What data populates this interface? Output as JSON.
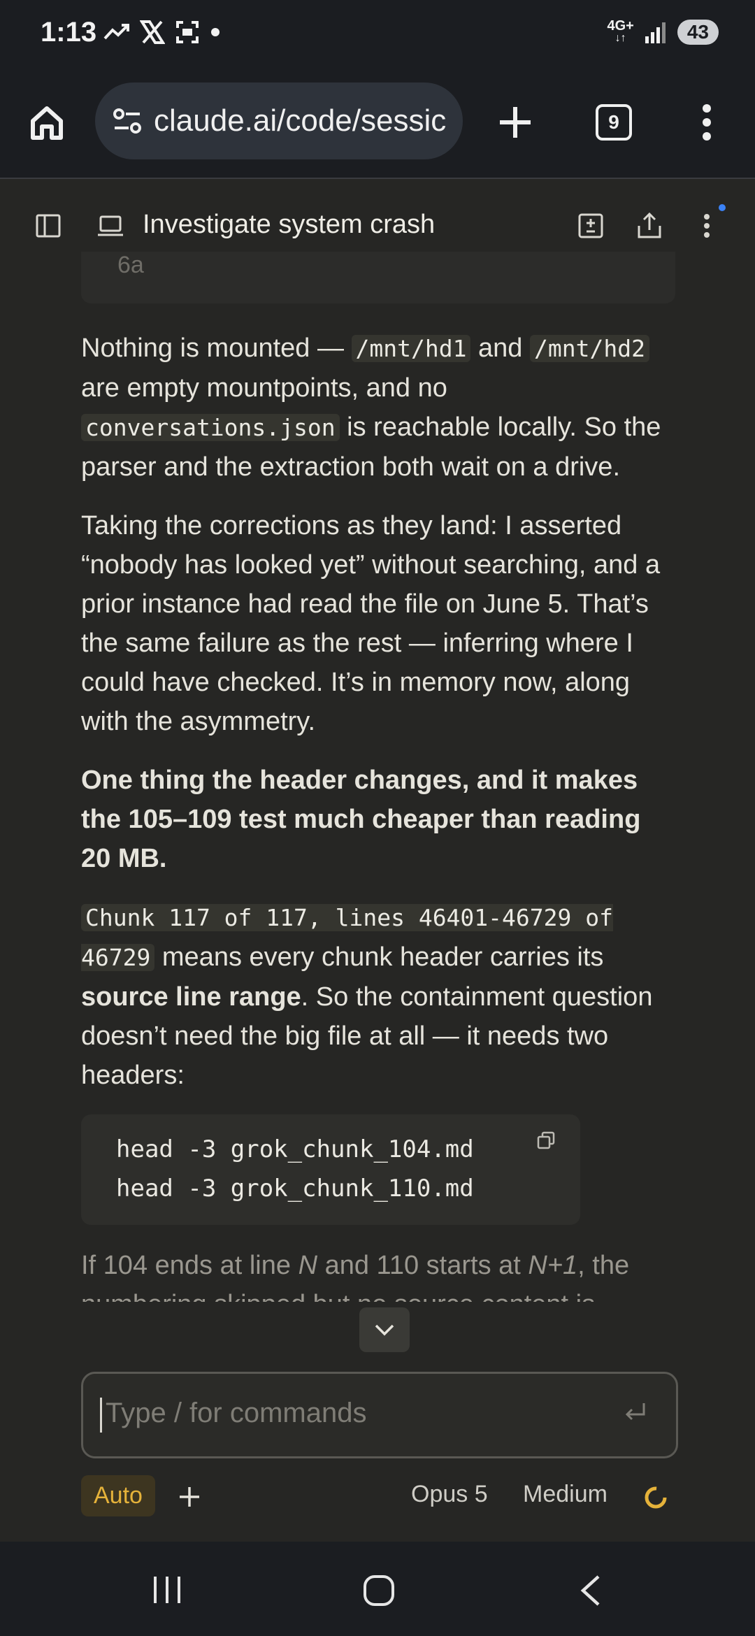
{
  "status_bar": {
    "time": "1:13",
    "network": "4G+",
    "battery": "43"
  },
  "browser": {
    "url": "claude.ai/code/sessic",
    "tabs_count": "9"
  },
  "session": {
    "title": "Investigate system crash"
  },
  "conversation": {
    "prev_block_text": "6a",
    "p1": {
      "t1": "Nothing is mounted — ",
      "c1": "/mnt/hd1",
      "t2": " and ",
      "c2": "/mnt/hd2",
      "t3": " are empty mountpoints, and no ",
      "c3": "conversations.json",
      "t4": " is reachable locally. So the parser and the extraction both wait on a drive."
    },
    "p2": "Taking the corrections as they land: I asserted “nobody has looked yet” without searching, and a prior instance had read the file on June 5. That’s the same failure as the rest — inferring where I could have checked. It’s in memory now, along with the asymmetry.",
    "p3": "One thing the header changes, and it makes the 105–109 test much cheaper than reading 20 MB.",
    "p4": {
      "c1": "Chunk 117 of 117, lines 46401-46729 of 46729",
      "t1": " means every chunk header carries its ",
      "b1": "source line range",
      "t2": ". So the containment question doesn’t need the big file at all — it needs two headers:"
    },
    "code_lines": [
      "head -3 grok_chunk_104.md",
      "head -3 grok_chunk_110.md"
    ],
    "p5": {
      "t1": "If 104 ends at line ",
      "i1": "N",
      "t2": " and 110 starts at ",
      "i2": "N+1",
      "t3": ", the numbering skipped but no source content is"
    }
  },
  "composer": {
    "placeholder": "Type / for commands",
    "mode": "Auto",
    "model": "Opus 5",
    "effort": "Medium"
  },
  "colors": {
    "accent": "#e5b23a",
    "background": "#262624",
    "bar": "#1b1d21"
  }
}
